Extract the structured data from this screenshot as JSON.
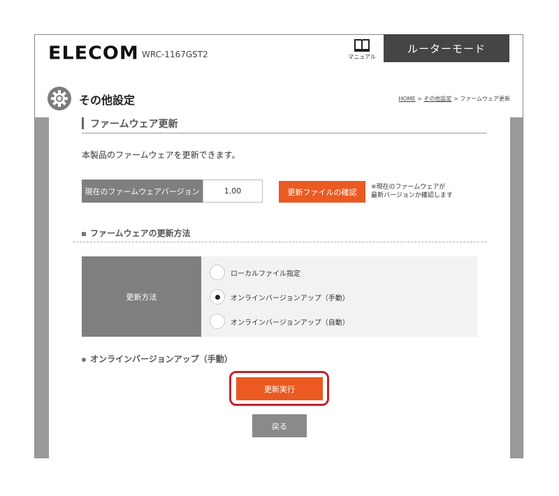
{
  "header": {
    "logo": "ELECOM",
    "model": "WRC-1167GST2",
    "manual_label": "マニュアル",
    "mode_tab": "ルーターモード"
  },
  "page": {
    "title": "その他設定",
    "breadcrumb": [
      "HOME",
      "その他設定",
      "ファームウェア更新"
    ],
    "breadcrumb_sep": ">"
  },
  "section": {
    "title": "ファームウェア更新",
    "description": "本製品のファームウェアを更新できます。"
  },
  "version": {
    "label": "現在のファームウェアバージョン",
    "value": "1.00",
    "check_button": "更新ファイルの確認",
    "note_line1": "※現在のファームウェアが",
    "note_line2": "最新バージョンか確認します"
  },
  "method": {
    "heading": "ファームウェアの更新方法",
    "label": "更新方法",
    "options": [
      {
        "label": "ローカルファイル指定",
        "selected": false
      },
      {
        "label": "オンラインバージョンアップ（手動）",
        "selected": true
      },
      {
        "label": "オンラインバージョンアップ（自動）",
        "selected": false
      }
    ]
  },
  "online": {
    "heading": "オンラインバージョンアップ（手動）",
    "execute_button": "更新実行",
    "back_button": "戻る"
  },
  "colors": {
    "accent": "#ea5a22",
    "highlight": "#c0232e",
    "dark_tab": "#454545",
    "label_bg": "#7f7f7f"
  }
}
